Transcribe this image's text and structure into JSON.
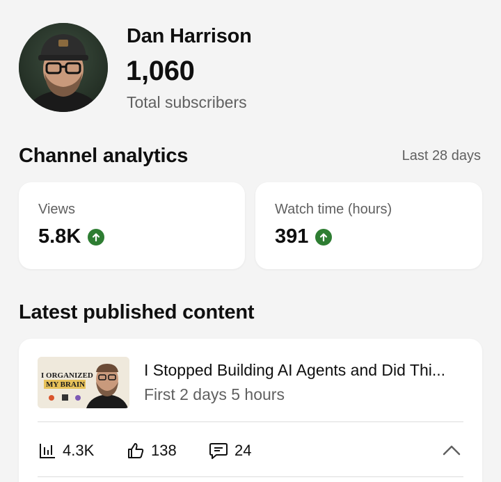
{
  "channel": {
    "name": "Dan Harrison",
    "subscribers": "1,060",
    "subscribers_label": "Total subscribers"
  },
  "analytics": {
    "title": "Channel analytics",
    "period": "Last 28 days",
    "metrics": [
      {
        "label": "Views",
        "value": "5.8K",
        "trend": "up"
      },
      {
        "label": "Watch time (hours)",
        "value": "391",
        "trend": "up"
      }
    ]
  },
  "latest": {
    "title": "Latest published content",
    "video": {
      "title": "I Stopped Building AI Agents and Did Thi...",
      "subtitle": "First 2 days 5 hours",
      "thumbnail_text_line1": "I ORGANIZED",
      "thumbnail_text_line2": "MY BRAIN",
      "stats": {
        "views": "4.3K",
        "likes": "138",
        "comments": "24"
      }
    }
  },
  "colors": {
    "trend_up": "#2e7d32",
    "muted": "#606060",
    "background": "#f4f4f4"
  },
  "icons": [
    "arrow-up-icon",
    "bar-chart-icon",
    "thumbs-up-icon",
    "comment-icon",
    "chevron-up-icon"
  ]
}
